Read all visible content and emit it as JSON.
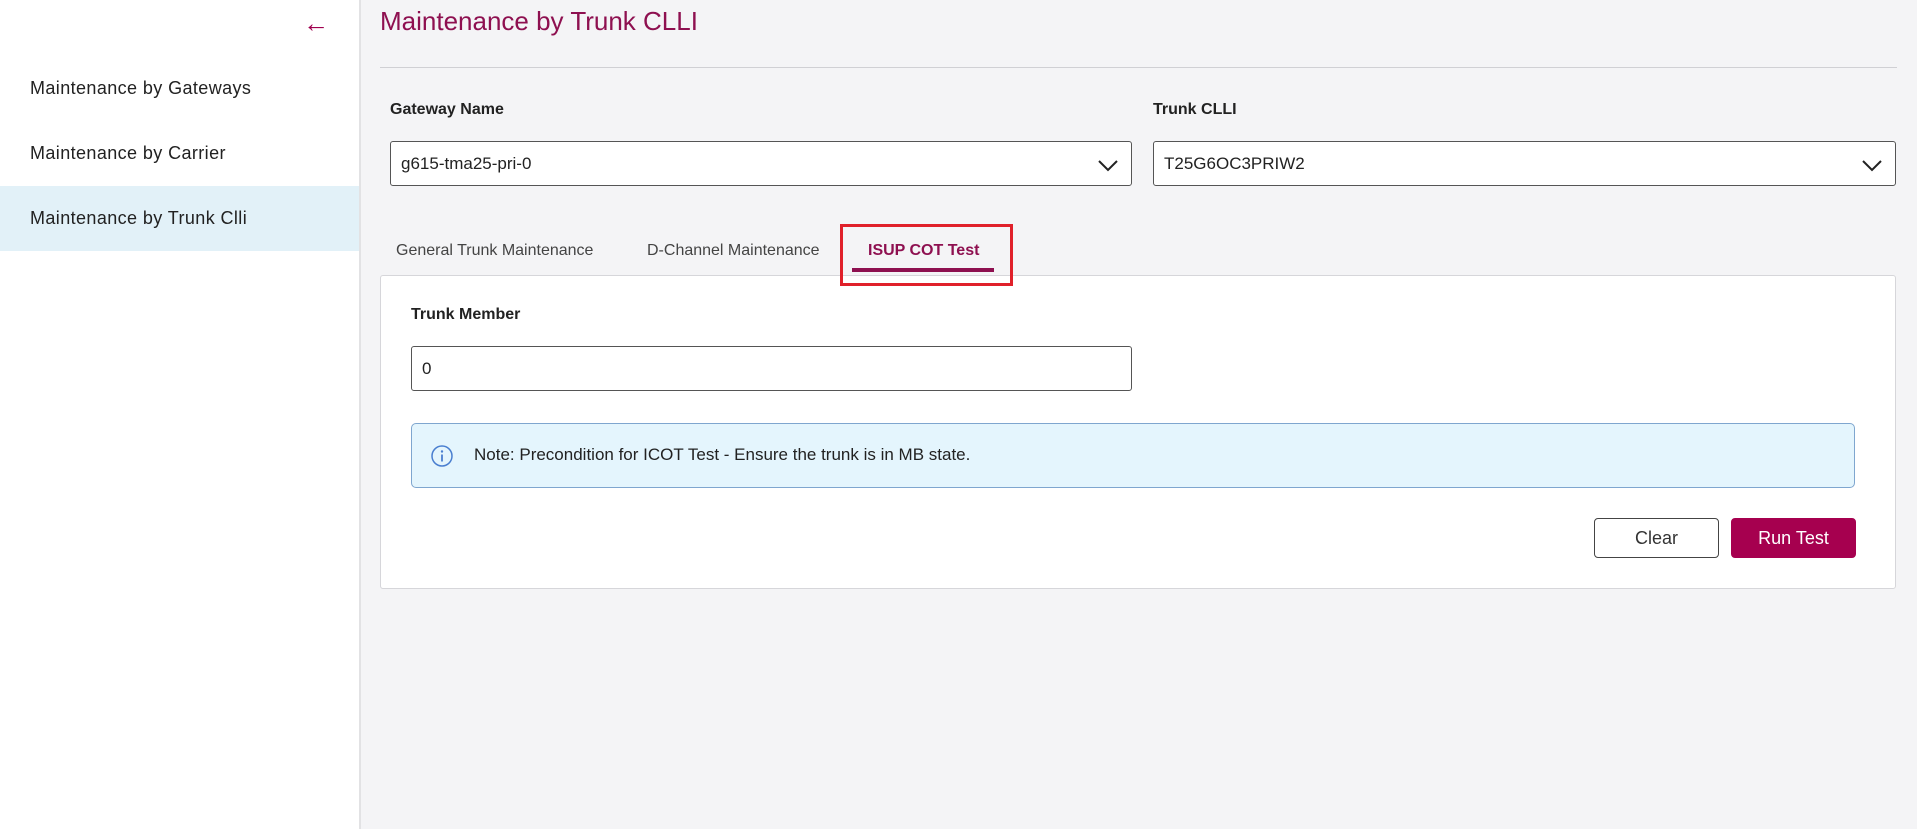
{
  "sidebar": {
    "back_icon": "arrow-left-icon",
    "items": [
      {
        "label": "Maintenance by Gateways"
      },
      {
        "label": "Maintenance by Carrier"
      },
      {
        "label": "Maintenance by Trunk Clli",
        "active": true
      }
    ]
  },
  "page": {
    "title": "Maintenance by Trunk CLLI"
  },
  "filters": {
    "gateway_label": "Gateway Name",
    "gateway_value": "g615-tma25-pri-0",
    "trunk_label": "Trunk CLLI",
    "trunk_value": "T25G6OC3PRIW2"
  },
  "tabs": [
    {
      "label": "General Trunk Maintenance"
    },
    {
      "label": "D-Channel Maintenance"
    },
    {
      "label": "ISUP COT Test",
      "active": true
    }
  ],
  "panel": {
    "member_label": "Trunk Member",
    "member_value": "0",
    "note": "Note: Precondition for ICOT Test - Ensure the trunk is in MB state.",
    "clear_label": "Clear",
    "run_label": "Run Test"
  },
  "colors": {
    "accent": "#a6004f",
    "title": "#8e1050",
    "highlight": "#e0202a"
  }
}
